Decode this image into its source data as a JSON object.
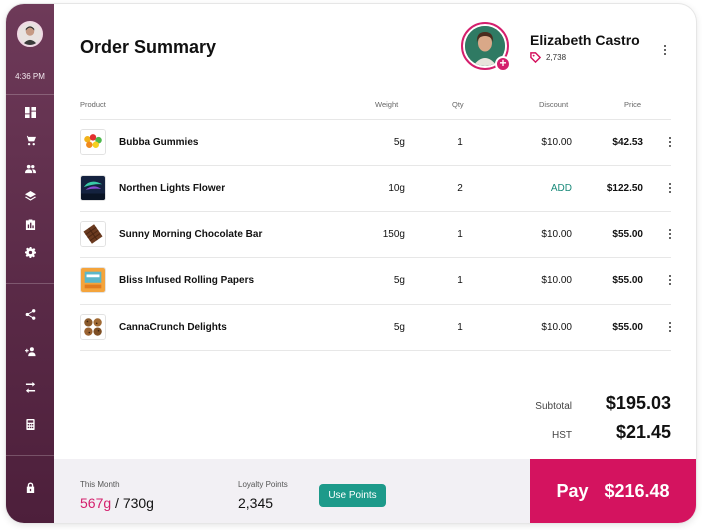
{
  "sidebar": {
    "time": "4:36 PM",
    "top_icons": [
      "dashboard-icon",
      "cart-icon",
      "people-icon",
      "layers-icon",
      "clipboard-icon",
      "gear-icon"
    ],
    "bottom_icons": [
      "share-icon",
      "add-person-icon",
      "swap-icon",
      "calculator-icon"
    ],
    "lock_icon": "lock-icon"
  },
  "header": {
    "title": "Order Summary",
    "customer_name": "Elizabeth Castro",
    "customer_points": "2,738"
  },
  "table": {
    "columns": {
      "product": "Product",
      "weight": "Weight",
      "qty": "Qty",
      "discount": "Discount",
      "price": "Price"
    },
    "rows": [
      {
        "product": "Bubba Gummies",
        "weight": "5g",
        "qty": "1",
        "discount": "$10.00",
        "price": "$42.53"
      },
      {
        "product": "Northen Lights Flower",
        "weight": "10g",
        "qty": "2",
        "discount": "ADD",
        "price": "$122.50"
      },
      {
        "product": "Sunny Morning Chocolate Bar",
        "weight": "150g",
        "qty": "1",
        "discount": "$10.00",
        "price": "$55.00"
      },
      {
        "product": "Bliss Infused Rolling Papers",
        "weight": "5g",
        "qty": "1",
        "discount": "$10.00",
        "price": "$55.00"
      },
      {
        "product": "CannaCrunch Delights",
        "weight": "5g",
        "qty": "1",
        "discount": "$10.00",
        "price": "$55.00"
      }
    ]
  },
  "totals": {
    "subtotal_label": "Subtotal",
    "subtotal_value": "$195.03",
    "hst_label": "HST",
    "hst_value": "$21.45"
  },
  "footer": {
    "month_label": "This Month",
    "month_used": "567g",
    "month_limit": " / 730g",
    "loyalty_label": "Loyalty Points",
    "loyalty_value": "2,345",
    "use_points_label": "Use Points",
    "pay_label": "Pay",
    "pay_amount": "$216.48"
  },
  "colors": {
    "accent": "#d4135f",
    "teal": "#1d9a8a",
    "sidebar": "#5a2a47"
  }
}
